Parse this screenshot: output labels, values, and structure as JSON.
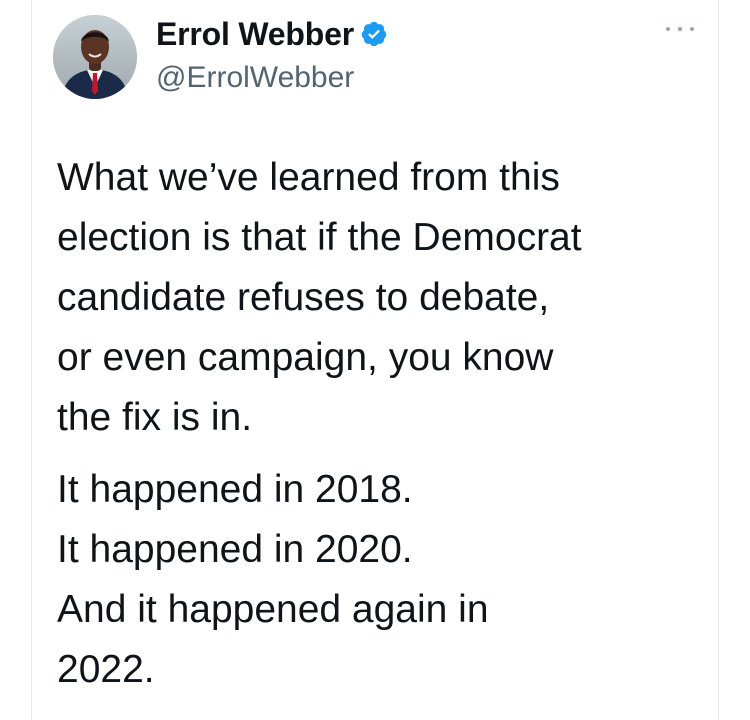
{
  "author": {
    "display_name": "Errol Webber",
    "handle": "@ErrolWebber",
    "verified": true,
    "avatar_icon": "profile-photo"
  },
  "menu": {
    "more_icon": "more-horizontal-icon"
  },
  "tweet": {
    "paragraphs": [
      {
        "lines": [
          "What we’ve learned from this",
          "election is that if the Democrat",
          "candidate refuses to debate,",
          "or even campaign, you know",
          "the fix is in."
        ]
      },
      {
        "lines": [
          "It happened in 2018.",
          "It happened in 2020.",
          "And it happened again in",
          "2022."
        ]
      }
    ]
  },
  "colors": {
    "text_primary": "#0f1419",
    "text_secondary": "#536471",
    "verified_blue": "#1d9bf0",
    "border": "#e6e8ea"
  }
}
